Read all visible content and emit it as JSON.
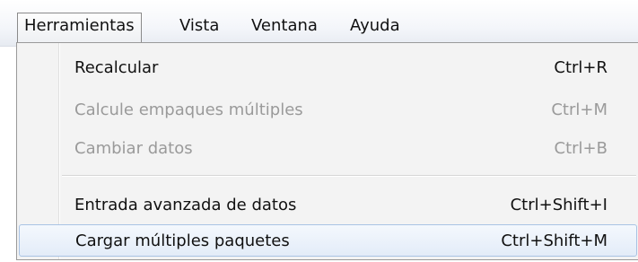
{
  "menubar": {
    "items": [
      {
        "label": "Herramientas"
      },
      {
        "label": "Vista"
      },
      {
        "label": "Ventana"
      },
      {
        "label": "Ayuda"
      }
    ]
  },
  "dropdown": {
    "items": [
      {
        "label": "Recalcular",
        "shortcut": "Ctrl+R",
        "enabled": true
      },
      {
        "label": "Calcule empaques múltiples",
        "shortcut": "Ctrl+M",
        "enabled": false
      },
      {
        "label": "Cambiar datos",
        "shortcut": "Ctrl+B",
        "enabled": false
      },
      {
        "label": "Entrada avanzada de datos",
        "shortcut": "Ctrl+Shift+I",
        "enabled": true
      },
      {
        "label": "Cargar múltiples paquetes",
        "shortcut": "Ctrl+Shift+M",
        "enabled": true,
        "highlighted": true
      }
    ]
  }
}
